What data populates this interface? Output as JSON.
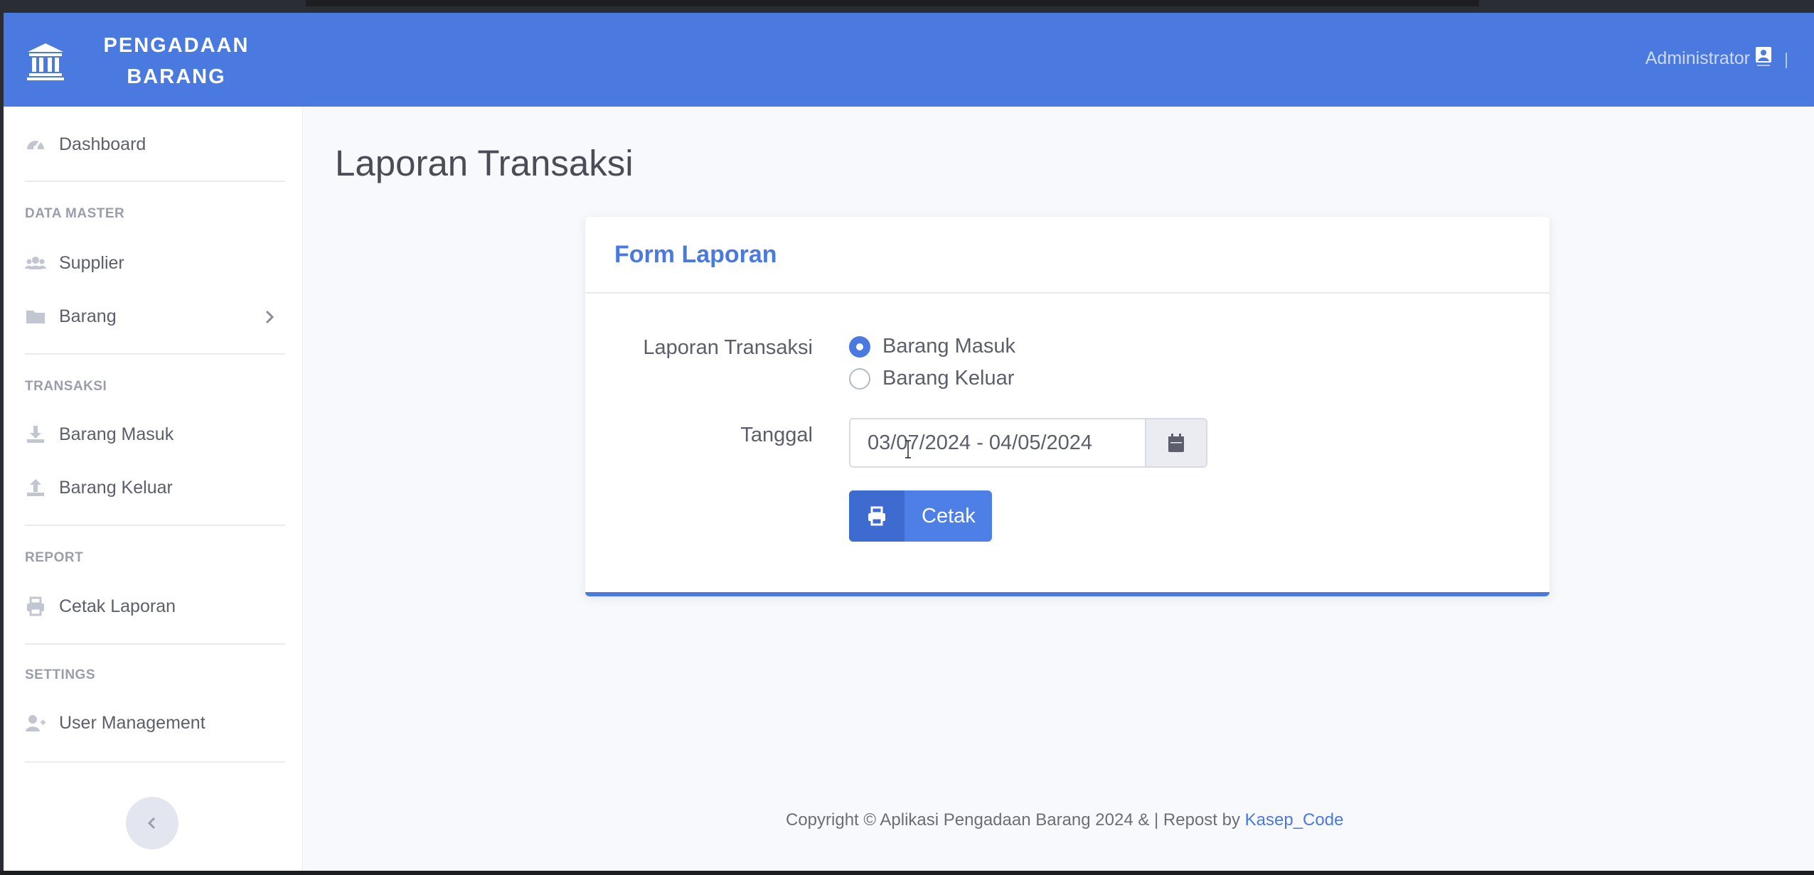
{
  "header": {
    "brand": "PENGADAAN BARANG",
    "brand_icon": "bank-icon",
    "user_name": "Administrator",
    "user_icon": "user-avatar-icon"
  },
  "sidebar": {
    "dashboard": {
      "label": "Dashboard",
      "icon": "tachometer-icon"
    },
    "sections": {
      "data_master": "DATA MASTER",
      "transaksi": "TRANSAKSI",
      "report": "REPORT",
      "settings": "SETTINGS"
    },
    "items": {
      "supplier": {
        "label": "Supplier",
        "icon": "users-icon"
      },
      "barang": {
        "label": "Barang",
        "icon": "folder-icon"
      },
      "barang_masuk": {
        "label": "Barang Masuk",
        "icon": "download-icon"
      },
      "barang_keluar": {
        "label": "Barang Keluar",
        "icon": "upload-icon"
      },
      "cetak_laporan": {
        "label": "Cetak Laporan",
        "icon": "print-icon"
      },
      "user_management": {
        "label": "User Management",
        "icon": "user-plus-icon"
      }
    }
  },
  "main": {
    "page_title": "Laporan Transaksi",
    "card": {
      "title": "Form Laporan",
      "laporan_label": "Laporan Transaksi",
      "options": [
        {
          "label": "Barang Masuk",
          "checked": true
        },
        {
          "label": "Barang Keluar",
          "checked": false
        }
      ],
      "tanggal_label": "Tanggal",
      "date_range_value": "03/07/2024 - 04/05/2024",
      "cetak_label": "Cetak"
    }
  },
  "footer": {
    "text": "Copyright © Aplikasi Pengadaan Barang 2024 & | Repost by ",
    "link": "Kasep_Code"
  },
  "colors": {
    "primary": "#4a79df",
    "background": "#f8f9fc"
  }
}
